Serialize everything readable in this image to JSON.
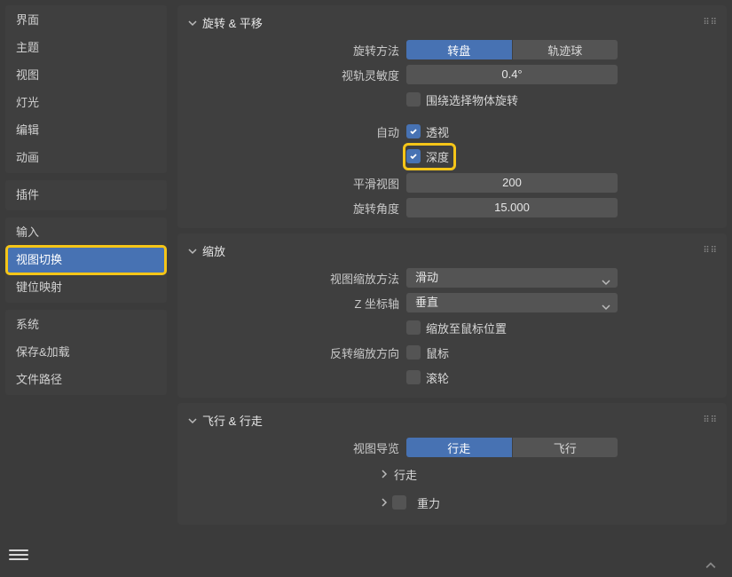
{
  "sidebar": {
    "group1": [
      "界面",
      "主题",
      "视图",
      "灯光",
      "编辑",
      "动画"
    ],
    "group2": [
      "插件"
    ],
    "group3": [
      "输入",
      "视图切换",
      "键位映射"
    ],
    "group4": [
      "系统",
      "保存&加载",
      "文件路径"
    ],
    "activeIndex": {
      "group": 3,
      "item": 1
    }
  },
  "panels": {
    "rotate": {
      "title": "旋转 & 平移",
      "rotMethodLabel": "旋转方法",
      "rotMethod": {
        "opt1": "转盘",
        "opt2": "轨迹球"
      },
      "orbitSensLabel": "视轨灵敏度",
      "orbitSensValue": "0.4°",
      "orbitSelLabel": "围绕选择物体旋转",
      "autoLabel": "自动",
      "autoPersp": "透视",
      "autoDepth": "深度",
      "smoothLabel": "平滑视图",
      "smoothValue": "200",
      "rotAngleLabel": "旋转角度",
      "rotAngleValue": "15.000"
    },
    "zoom": {
      "title": "缩放",
      "zoomMethodLabel": "视图缩放方法",
      "zoomMethodValue": "滑动",
      "zAxisLabel": "Z 坐标轴",
      "zAxisValue": "垂直",
      "zoomToMouse": "缩放至鼠标位置",
      "invertLabel": "反转缩放方向",
      "invertMouse": "鼠标",
      "invertWheel": "滚轮"
    },
    "fly": {
      "title": "飞行 & 行走",
      "navLabel": "视图导览",
      "nav": {
        "opt1": "行走",
        "opt2": "飞行"
      },
      "walkSub": "行走",
      "gravitySub": "重力"
    }
  }
}
